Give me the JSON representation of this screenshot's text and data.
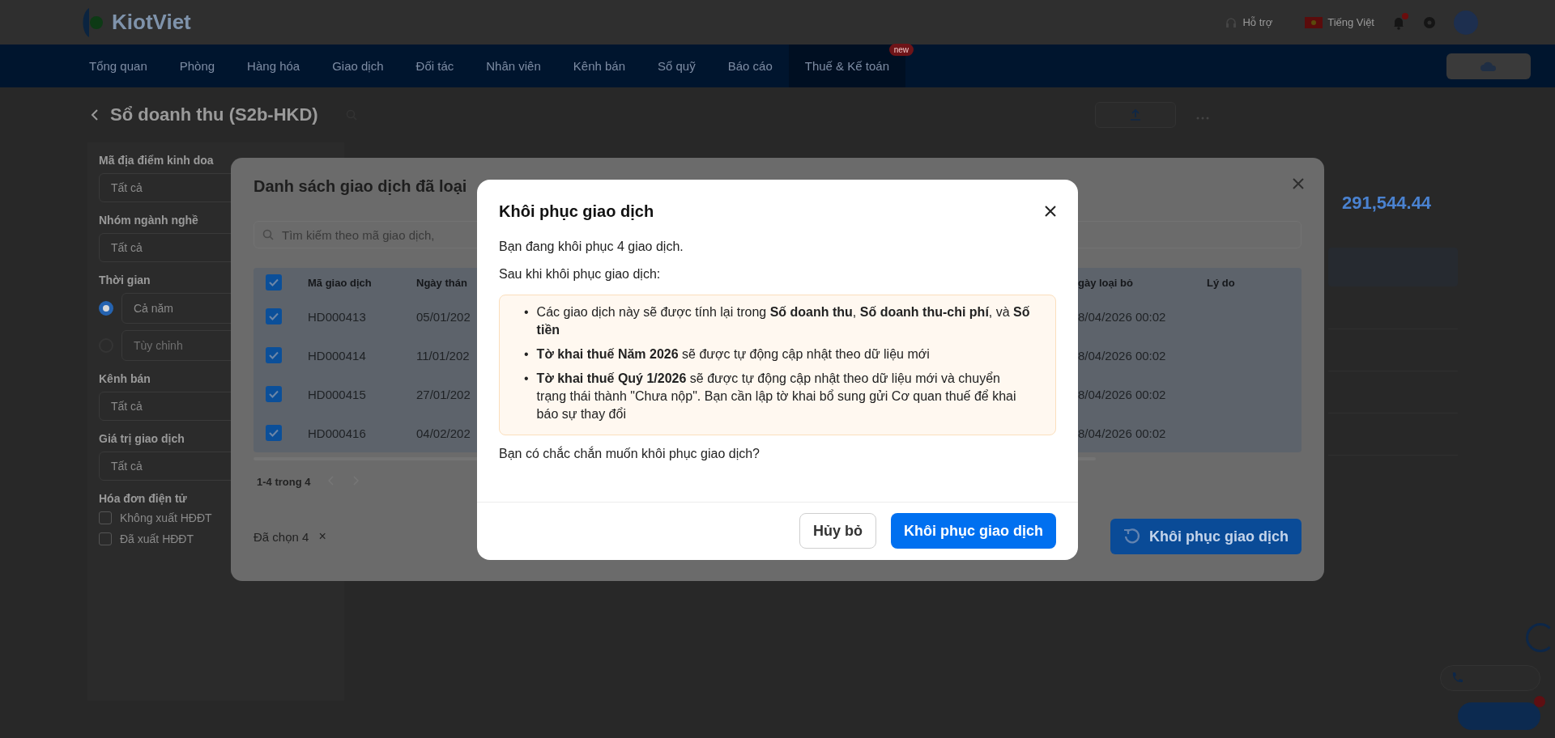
{
  "header": {
    "logo": "KiotViet",
    "links": [
      {
        "label": "Hỗ trợ",
        "kind": "help"
      },
      {
        "label": "Tiếng Việt",
        "kind": "language"
      }
    ],
    "notifications": {
      "unread": true
    }
  },
  "nav": {
    "items": [
      {
        "label": "Tổng quan",
        "selected": false
      },
      {
        "label": "Phòng",
        "selected": false
      },
      {
        "label": "Hàng hóa",
        "selected": false
      },
      {
        "label": "Giao dịch",
        "selected": false
      },
      {
        "label": "Đối tác",
        "selected": false
      },
      {
        "label": "Nhân viên",
        "selected": false
      },
      {
        "label": "Kênh bán",
        "selected": false
      },
      {
        "label": "Sổ quỹ",
        "selected": false
      },
      {
        "label": "Báo cáo",
        "selected": false
      },
      {
        "label": "Thuế & Kế toán",
        "selected": true,
        "badge": "new"
      }
    ]
  },
  "page": {
    "title": "Sổ doanh thu (S2b-HKD)",
    "total": "291,544.44"
  },
  "filters": [
    {
      "kind": "select",
      "label": "Mã địa điểm kinh doa",
      "value": "Tất cả"
    },
    {
      "kind": "select",
      "label": "Nhóm ngành nghề",
      "value": "Tất cả"
    },
    {
      "kind": "radio",
      "label": "Thời gian",
      "options": [
        {
          "label": "Cả năm",
          "selected": true
        },
        {
          "label": "Tùy chỉnh",
          "selected": false
        }
      ]
    },
    {
      "kind": "select",
      "label": "Kênh bán",
      "value": "Tất cả"
    },
    {
      "kind": "select",
      "label": "Giá trị giao dịch",
      "value": "Tất cả"
    },
    {
      "kind": "checkbox",
      "label": "Hóa đơn điện tử",
      "options": [
        {
          "label": "Không xuất HĐĐT",
          "checked": false
        },
        {
          "label": "Đã xuất HĐĐT",
          "checked": false
        }
      ]
    }
  ],
  "list_dialog": {
    "title": "Danh sách giao dịch đã loại",
    "search": {
      "placeholder": "Tìm kiếm theo mã giao dịch,"
    },
    "table": {
      "all_checked": true,
      "columns": [
        "Mã giao dịch",
        "Ngày thán",
        "gày loại bỏ",
        "Lý do"
      ],
      "rows": [
        {
          "checked": true,
          "code": "HD000413",
          "date": "05/01/202",
          "removed": "8/04/2026 00:02"
        },
        {
          "checked": true,
          "code": "HD000414",
          "date": "11/01/202",
          "removed": "8/04/2026 00:02"
        },
        {
          "checked": true,
          "code": "HD000415",
          "date": "27/01/202",
          "removed": "8/04/2026 00:02"
        },
        {
          "checked": true,
          "code": "HD000416",
          "date": "04/02/202",
          "removed": "8/04/2026 00:02"
        }
      ]
    },
    "pagination": "1-4 trong 4",
    "selected_count": "Đã chọn 4",
    "clear": "×",
    "restore_button": "Khôi phục giao dịch"
  },
  "modal": {
    "title": "Khôi phục giao dịch",
    "intro": "Bạn đang khôi phục 4 giao dịch.",
    "lead": "Sau khi khôi phục giao dịch:",
    "bullets": [
      {
        "marker": "•",
        "text": "Các giao dịch này sẽ được tính lại trong **Số doanh thu**, **Số doanh thu-chi phí**, và **Số tiền**"
      },
      {
        "marker": "•",
        "text": "**Tờ khai thuế Năm 2026** sẽ được tự động cập nhật theo dữ liệu mới"
      },
      {
        "marker": "•",
        "text": "**Tờ khai thuế Quý 1/2026** sẽ được tự động cập nhật theo dữ liệu mới và chuyển trạng thái thành \"Chưa nộp\". Bạn cần lập tờ khai bổ sung gửi Cơ quan thuế để khai báo sự thay đổi"
      }
    ],
    "question": "Bạn có chắc chắn muốn khôi phục giao dịch?",
    "buttons": [
      {
        "label": "Hủy bỏ",
        "kind": "secondary"
      },
      {
        "label": "Khôi phục giao dịch",
        "kind": "primary"
      }
    ]
  }
}
